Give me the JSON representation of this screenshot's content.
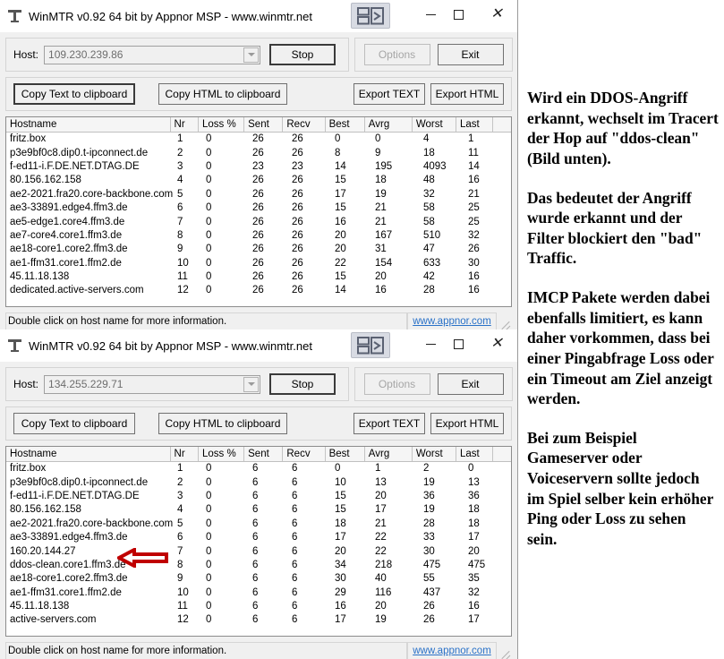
{
  "windows": [
    {
      "title": "WinMTR v0.92 64 bit by Appnor MSP - www.winmtr.net",
      "host_label": "Host:",
      "host_value": "109.230.239.86",
      "stop_label": "Stop",
      "options_label": "Options",
      "exit_label": "Exit",
      "copy_text_label": "Copy Text to clipboard",
      "copy_html_label": "Copy HTML to clipboard",
      "export_text_label": "Export TEXT",
      "export_html_label": "Export HTML",
      "status_text": "Double click on host name for more information.",
      "status_link": "www.appnor.com",
      "columns": [
        "Hostname",
        "Nr",
        "Loss %",
        "Sent",
        "Recv",
        "Best",
        "Avrg",
        "Worst",
        "Last"
      ],
      "rows": [
        [
          "fritz.box",
          "1",
          "0",
          "26",
          "26",
          "0",
          "0",
          "4",
          "1"
        ],
        [
          "p3e9bf0c8.dip0.t-ipconnect.de",
          "2",
          "0",
          "26",
          "26",
          "8",
          "9",
          "18",
          "11"
        ],
        [
          "f-ed11-i.F.DE.NET.DTAG.DE",
          "3",
          "0",
          "23",
          "23",
          "14",
          "195",
          "4093",
          "14"
        ],
        [
          "80.156.162.158",
          "4",
          "0",
          "26",
          "26",
          "15",
          "18",
          "48",
          "16"
        ],
        [
          "ae2-2021.fra20.core-backbone.com",
          "5",
          "0",
          "26",
          "26",
          "17",
          "19",
          "32",
          "21"
        ],
        [
          "ae3-33891.edge4.ffm3.de",
          "6",
          "0",
          "26",
          "26",
          "15",
          "21",
          "58",
          "25"
        ],
        [
          "ae5-edge1.core4.ffm3.de",
          "7",
          "0",
          "26",
          "26",
          "16",
          "21",
          "58",
          "25"
        ],
        [
          "ae7-core4.core1.ffm3.de",
          "8",
          "0",
          "26",
          "26",
          "20",
          "167",
          "510",
          "32"
        ],
        [
          "ae18-core1.core2.ffm3.de",
          "9",
          "0",
          "26",
          "26",
          "20",
          "31",
          "47",
          "26"
        ],
        [
          "ae1-ffm31.core1.ffm2.de",
          "10",
          "0",
          "26",
          "26",
          "22",
          "154",
          "633",
          "30"
        ],
        [
          "45.11.18.138",
          "11",
          "0",
          "26",
          "26",
          "15",
          "20",
          "42",
          "16"
        ],
        [
          "dedicated.active-servers.com",
          "12",
          "0",
          "26",
          "26",
          "14",
          "16",
          "28",
          "16"
        ]
      ]
    },
    {
      "title": "WinMTR v0.92 64 bit by Appnor MSP - www.winmtr.net",
      "host_label": "Host:",
      "host_value": "134.255.229.71",
      "stop_label": "Stop",
      "options_label": "Options",
      "exit_label": "Exit",
      "copy_text_label": "Copy Text to clipboard",
      "copy_html_label": "Copy HTML to clipboard",
      "export_text_label": "Export TEXT",
      "export_html_label": "Export HTML",
      "status_text": "Double click on host name for more information.",
      "status_link": "www.appnor.com",
      "columns": [
        "Hostname",
        "Nr",
        "Loss %",
        "Sent",
        "Recv",
        "Best",
        "Avrg",
        "Worst",
        "Last"
      ],
      "rows": [
        [
          "fritz.box",
          "1",
          "0",
          "6",
          "6",
          "0",
          "1",
          "2",
          "0"
        ],
        [
          "p3e9bf0c8.dip0.t-ipconnect.de",
          "2",
          "0",
          "6",
          "6",
          "10",
          "13",
          "19",
          "13"
        ],
        [
          "f-ed11-i.F.DE.NET.DTAG.DE",
          "3",
          "0",
          "6",
          "6",
          "15",
          "20",
          "36",
          "36"
        ],
        [
          "80.156.162.158",
          "4",
          "0",
          "6",
          "6",
          "15",
          "17",
          "19",
          "18"
        ],
        [
          "ae2-2021.fra20.core-backbone.com",
          "5",
          "0",
          "6",
          "6",
          "18",
          "21",
          "28",
          "18"
        ],
        [
          "ae3-33891.edge4.ffm3.de",
          "6",
          "0",
          "6",
          "6",
          "17",
          "22",
          "33",
          "17"
        ],
        [
          "160.20.144.27",
          "7",
          "0",
          "6",
          "6",
          "20",
          "22",
          "30",
          "20"
        ],
        [
          "ddos-clean.core1.ffm3.de",
          "8",
          "0",
          "6",
          "6",
          "34",
          "218",
          "475",
          "475"
        ],
        [
          "ae18-core1.core2.ffm3.de",
          "9",
          "0",
          "6",
          "6",
          "30",
          "40",
          "55",
          "35"
        ],
        [
          "ae1-ffm31.core1.ffm2.de",
          "10",
          "0",
          "6",
          "6",
          "29",
          "116",
          "437",
          "32"
        ],
        [
          "45.11.18.138",
          "11",
          "0",
          "6",
          "6",
          "16",
          "20",
          "26",
          "16"
        ],
        [
          "active-servers.com",
          "12",
          "0",
          "6",
          "6",
          "17",
          "19",
          "26",
          "17"
        ]
      ]
    }
  ],
  "annotation": {
    "arrow_color": "#c00000",
    "arrow_target_row": "ddos-clean.core1.ffm3.de"
  },
  "notes": {
    "paragraphs": [
      "Wird ein DDOS-Angriff erkannt, wechselt im Tracert der Hop auf \"ddos-clean\" (Bild unten).",
      "Das bedeutet der Angriff wurde erkannt und der Filter blockiert den \"bad\" Traffic.",
      "IMCP Pakete werden dabei ebenfalls limitiert, es kann daher vorkommen, dass bei einer Pingabfrage Loss oder ein Timeout am Ziel anzeigt werden.",
      "Bei zum Beispiel Gameserver oder Voiceservern sollte jedoch im Spiel selber kein erhöher Ping oder Loss zu sehen sein."
    ]
  }
}
